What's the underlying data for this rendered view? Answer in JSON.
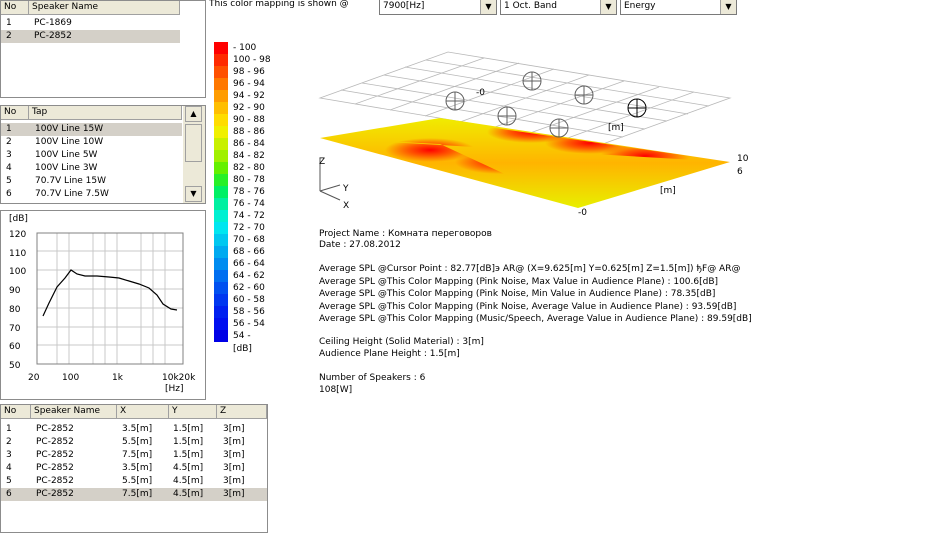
{
  "top": {
    "mapping_label": "This color mapping is shown @",
    "frequency": "7900[Hz]",
    "band": "1 Oct. Band",
    "metric": "Energy"
  },
  "speaker_list": {
    "columns": [
      "No",
      "Speaker Name"
    ],
    "rows": [
      [
        "1",
        "PC-1869"
      ],
      [
        "2",
        "PC-2852"
      ]
    ]
  },
  "tap_list": {
    "columns": [
      "No",
      "Tap"
    ],
    "rows": [
      [
        "1",
        "100V Line  15W"
      ],
      [
        "2",
        "100V Line  10W"
      ],
      [
        "3",
        "100V Line  5W"
      ],
      [
        "4",
        "100V Line  3W"
      ],
      [
        "5",
        "70.7V Line  15W"
      ],
      [
        "6",
        "70.7V Line  7.5W"
      ]
    ]
  },
  "freq_chart": {
    "ylabel": "[dB]",
    "xlabel": "[Hz]",
    "y_ticks": [
      "120",
      "110",
      "100",
      "90",
      "80",
      "70",
      "60",
      "50"
    ],
    "x_ticks": [
      "20",
      "100",
      "1k",
      "10k20k"
    ]
  },
  "legend": {
    "unit": "[dB]",
    "items": [
      {
        "label": " - 100",
        "color": "#ff0000"
      },
      {
        "label": "100 - 98",
        "color": "#ff2a00"
      },
      {
        "label": "98 - 96",
        "color": "#ff5000"
      },
      {
        "label": "96 - 94",
        "color": "#ff7800"
      },
      {
        "label": "94 - 92",
        "color": "#ff9c00"
      },
      {
        "label": "92 - 90",
        "color": "#ffbe00"
      },
      {
        "label": "90 - 88",
        "color": "#ffdc00"
      },
      {
        "label": "88 - 86",
        "color": "#f0f000"
      },
      {
        "label": "86 - 84",
        "color": "#c8f000"
      },
      {
        "label": "84 - 82",
        "color": "#a0f000"
      },
      {
        "label": "82 - 80",
        "color": "#64f000"
      },
      {
        "label": "80 - 78",
        "color": "#28f028"
      },
      {
        "label": "78 - 76",
        "color": "#00f064"
      },
      {
        "label": "76 - 74",
        "color": "#00f0a0"
      },
      {
        "label": "74 - 72",
        "color": "#00f0d2"
      },
      {
        "label": "72 - 70",
        "color": "#00e6f0"
      },
      {
        "label": "70 - 68",
        "color": "#00c8f0"
      },
      {
        "label": "68 - 66",
        "color": "#00aaf0"
      },
      {
        "label": "66 - 64",
        "color": "#008cf0"
      },
      {
        "label": "64 - 62",
        "color": "#006ef0"
      },
      {
        "label": "62 - 60",
        "color": "#0050f0"
      },
      {
        "label": "60 - 58",
        "color": "#0037f0"
      },
      {
        "label": "58 - 56",
        "color": "#0020f0"
      },
      {
        "label": "56 - 54",
        "color": "#000ff0"
      },
      {
        "label": "54 - ",
        "color": "#0000e6"
      }
    ]
  },
  "view3d": {
    "axis_z": "Z",
    "axis_y": "Y",
    "axis_x": "X",
    "label_m1": "[m]",
    "label_m2": "[m]",
    "label_neg0_top": "-0",
    "label_10": "10",
    "label_6": "6",
    "label_neg0_bottom": "-0"
  },
  "info": {
    "project": "Project Name : Комната переговоров",
    "date": "Date : 27.08.2012",
    "avg_cursor": "Average SPL @Cursor Point : 82.77[dB]э        AR@  (X=9.625[m] Y=0.625[m] Z=1.5[m]) ђF@         AR@",
    "avg_max": "Average SPL @This Color Mapping (Pink Noise, Max Value in Audience Plane) : 100.6[dB]",
    "avg_min": "Average SPL @This Color Mapping (Pink Noise, Min Value in Audience Plane) : 78.35[dB]",
    "avg_avg": "Average SPL @This Color Mapping (Pink Noise, Average Value in Audience Plane) : 93.59[dB]",
    "avg_music": "Average SPL @This Color Mapping (Music/Speech, Average Value in Audience Plane) : 89.59[dB]",
    "ceiling": "Ceiling Height (Solid Material) : 3[m]",
    "audience": "Audience Plane Height : 1.5[m]",
    "num_speakers": "Number of Speakers : 6",
    "power": "108[W]"
  },
  "speaker_table": {
    "columns": [
      "No",
      "Speaker Name",
      "X",
      "Y",
      "Z"
    ],
    "rows": [
      [
        "1",
        "PC-2852",
        "3.5[m]",
        "1.5[m]",
        "3[m]"
      ],
      [
        "2",
        "PC-2852",
        "5.5[m]",
        "1.5[m]",
        "3[m]"
      ],
      [
        "3",
        "PC-2852",
        "7.5[m]",
        "1.5[m]",
        "3[m]"
      ],
      [
        "4",
        "PC-2852",
        "3.5[m]",
        "4.5[m]",
        "3[m]"
      ],
      [
        "5",
        "PC-2852",
        "5.5[m]",
        "4.5[m]",
        "3[m]"
      ],
      [
        "6",
        "PC-2852",
        "7.5[m]",
        "4.5[m]",
        "3[m]"
      ]
    ]
  }
}
